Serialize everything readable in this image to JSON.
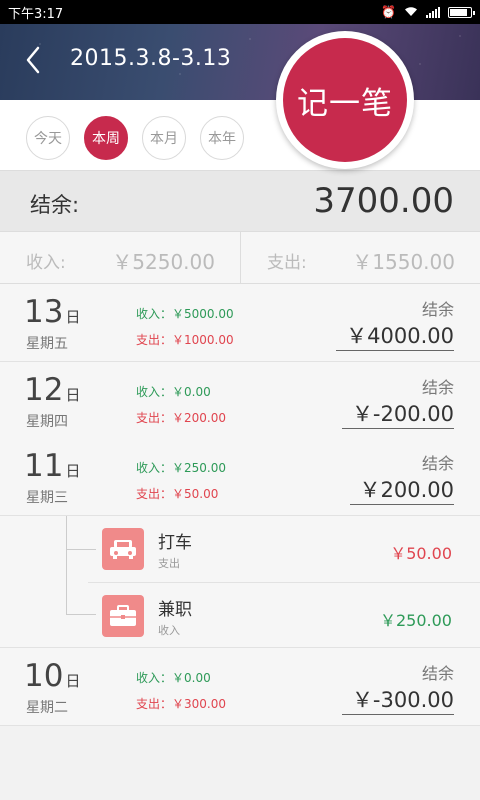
{
  "status_bar": {
    "time": "下午3:17",
    "battery_level": 0.9
  },
  "header": {
    "date_range": "2015.3.8-3.13",
    "add_label": "记一笔"
  },
  "tabs": [
    {
      "label": "今天",
      "active": false
    },
    {
      "label": "本周",
      "active": true
    },
    {
      "label": "本月",
      "active": false
    },
    {
      "label": "本年",
      "active": false
    }
  ],
  "summary": {
    "balance_label": "结余:",
    "balance_value": "3700.00",
    "income_label": "收入:",
    "income_value": "￥5250.00",
    "expense_label": "支出:",
    "expense_value": "￥1550.00"
  },
  "days": [
    {
      "day": "13",
      "day_suffix": "日",
      "weekday": "星期五",
      "income": "收入：￥5000.00",
      "expense": "支出：￥1000.00",
      "balance_label": "结余",
      "balance": "￥4000.00"
    },
    {
      "day": "12",
      "day_suffix": "日",
      "weekday": "星期四",
      "income": "收入：￥0.00",
      "expense": "支出：￥200.00",
      "balance_label": "结余",
      "balance": "￥-200.00"
    },
    {
      "day": "11",
      "day_suffix": "日",
      "weekday": "星期三",
      "income": "收入：￥250.00",
      "expense": "支出：￥50.00",
      "balance_label": "结余",
      "balance": "￥200.00"
    },
    {
      "day": "10",
      "day_suffix": "日",
      "weekday": "星期二",
      "income": "收入：￥0.00",
      "expense": "支出：￥300.00",
      "balance_label": "结余",
      "balance": "￥-300.00"
    }
  ],
  "entries": [
    {
      "name": "打车",
      "type": "支出",
      "amount": "￥50.00",
      "icon": "car-icon",
      "color": "#e0454f"
    },
    {
      "name": "兼职",
      "type": "收入",
      "amount": "￥250.00",
      "icon": "briefcase-icon",
      "color": "#2e9a58"
    }
  ],
  "colors": {
    "accent": "#c72a4d",
    "income": "#2e9a58",
    "expense": "#e0454f",
    "icon_bg": "#f08a8a"
  }
}
